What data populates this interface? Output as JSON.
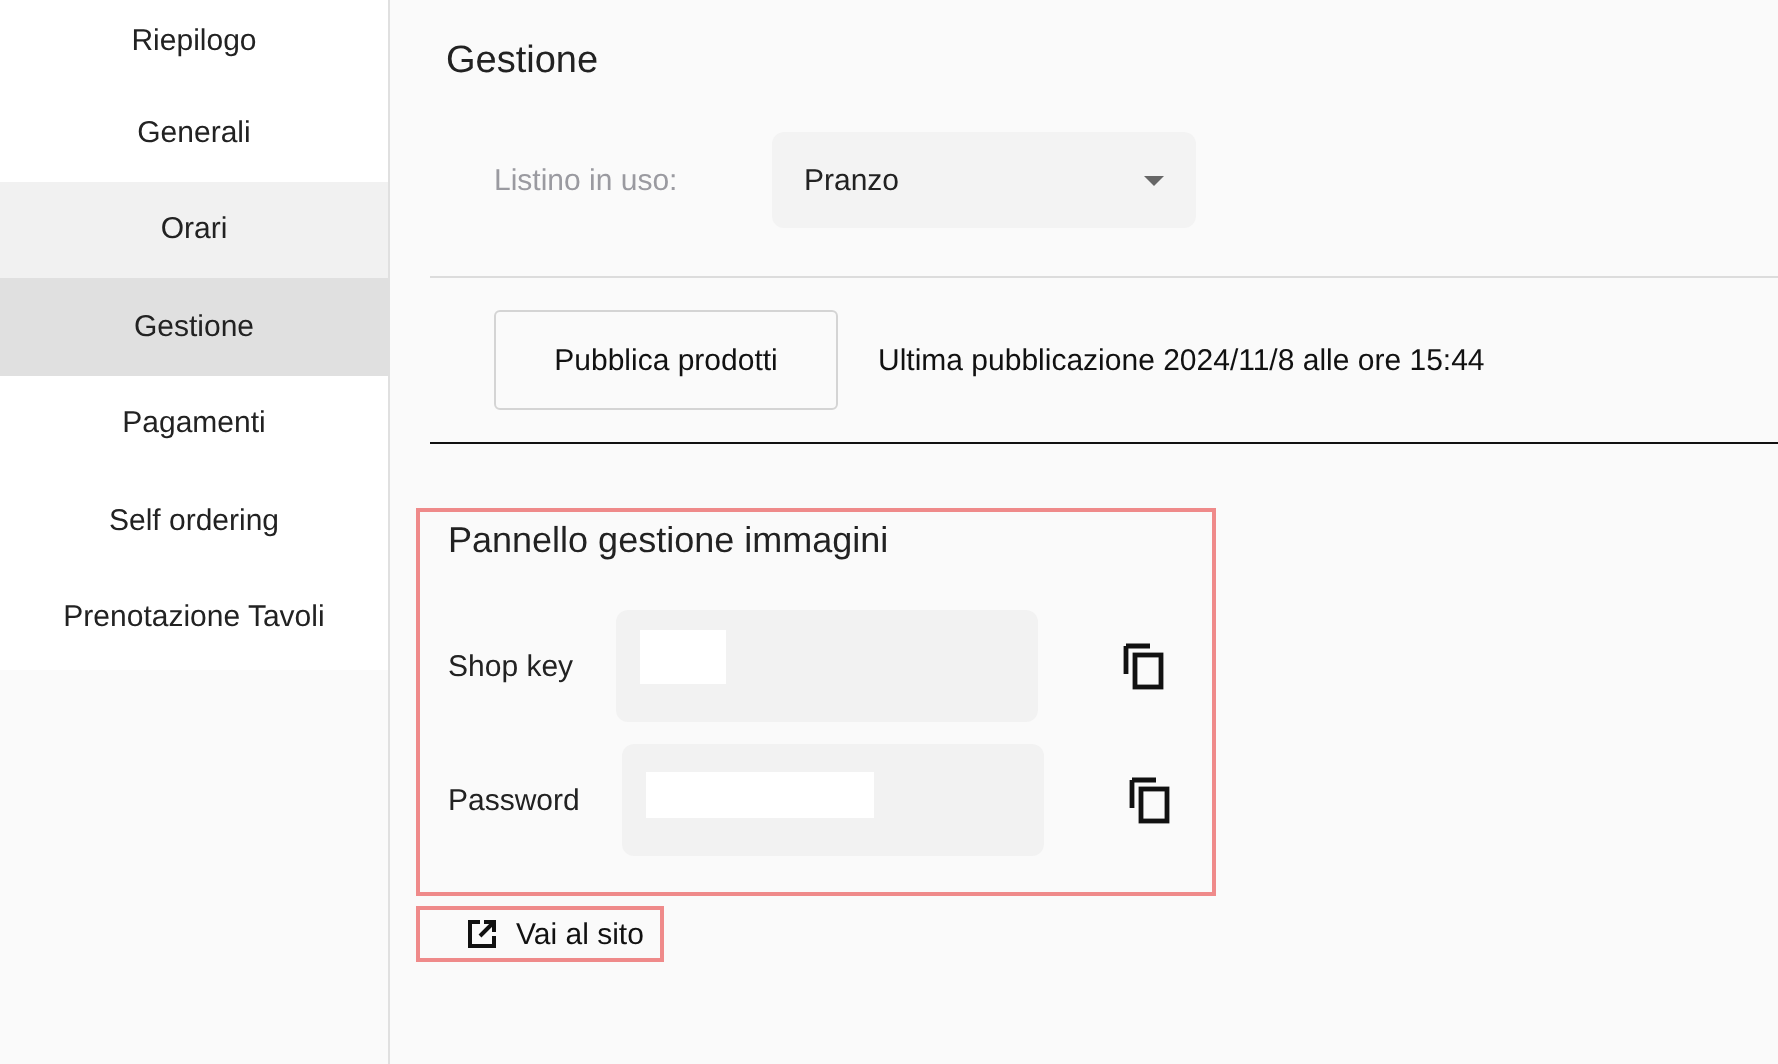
{
  "sidebar": {
    "items": [
      {
        "label": "Riepilogo",
        "selected": false,
        "hovered": false
      },
      {
        "label": "Generali",
        "selected": false,
        "hovered": false
      },
      {
        "label": "Orari",
        "selected": false,
        "hovered": true
      },
      {
        "label": "Gestione",
        "selected": true,
        "hovered": false
      },
      {
        "label": "Pagamenti",
        "selected": false,
        "hovered": false
      },
      {
        "label": "Self ordering",
        "selected": false,
        "hovered": false
      },
      {
        "label": "Prenotazione Tavoli",
        "selected": false,
        "hovered": false
      }
    ]
  },
  "page_title": "Gestione",
  "price_list": {
    "label": "Listino in uso:",
    "value": "Pranzo"
  },
  "publish": {
    "button": "Pubblica prodotti",
    "status": "Ultima pubblicazione 2024/11/8 alle ore 15:44"
  },
  "image_panel": {
    "title": "Pannello gestione immagini",
    "fields": [
      {
        "label": "Shop key"
      },
      {
        "label": "Password"
      }
    ]
  },
  "site_link": "Vai al sito"
}
